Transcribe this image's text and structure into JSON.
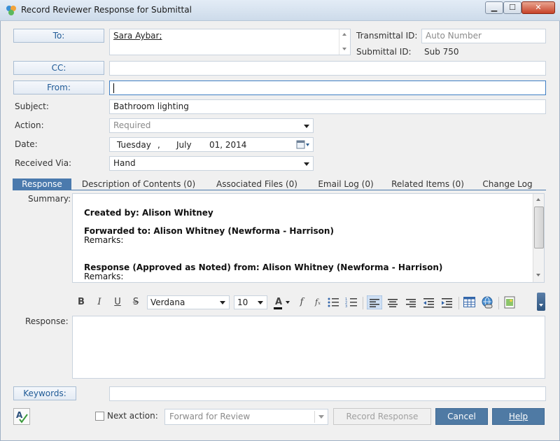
{
  "window": {
    "title": "Record Reviewer Response for Submittal",
    "minimize": "▁",
    "maximize": "☐",
    "close": "✕"
  },
  "to": {
    "label": "To:",
    "value": "Sara Aybar;"
  },
  "cc": {
    "label": "CC:",
    "value": ""
  },
  "from": {
    "label": "From:",
    "value": ""
  },
  "transmittal": {
    "label": "Transmittal ID:",
    "placeholder": "Auto Number"
  },
  "submittal": {
    "label": "Submittal ID:",
    "value": "Sub 750"
  },
  "subject": {
    "label": "Subject:",
    "value": "Bathroom lighting"
  },
  "action": {
    "label": "Action:",
    "placeholder": "Required"
  },
  "date": {
    "label": "Date:",
    "weekday": "Tuesday",
    "sep": ",",
    "month": "July",
    "daymonth": "01, 2014"
  },
  "received_via": {
    "label": "Received Via:",
    "value": "Hand"
  },
  "tabs": [
    {
      "label": "Response"
    },
    {
      "label": "Description of Contents (0)"
    },
    {
      "label": "Associated Files (0)"
    },
    {
      "label": "Email Log (0)"
    },
    {
      "label": "Related Items (0)"
    },
    {
      "label": "Change Log"
    }
  ],
  "summary": {
    "label": "Summary:",
    "lines": [
      "Created by: Alison Whitney",
      "Forwarded to: Alison Whitney (Newforma - Harrison)",
      "Remarks:",
      "Response (Approved as Noted) from: Alison Whitney (Newforma - Harrison)",
      "Remarks:"
    ]
  },
  "toolbar": {
    "bold": "B",
    "italic": "I",
    "underline": "U",
    "strike": "S",
    "font": "Verdana",
    "size": "10",
    "font_color": "A",
    "fx1": "f",
    "fx2": "fₓ"
  },
  "response": {
    "label": "Response:",
    "value": ""
  },
  "keywords": {
    "label": "Keywords:",
    "value": ""
  },
  "next_action": {
    "label": "Next action:",
    "placeholder": "Forward for Review"
  },
  "buttons": {
    "record": "Record Response",
    "cancel": "Cancel",
    "help": "Help"
  }
}
